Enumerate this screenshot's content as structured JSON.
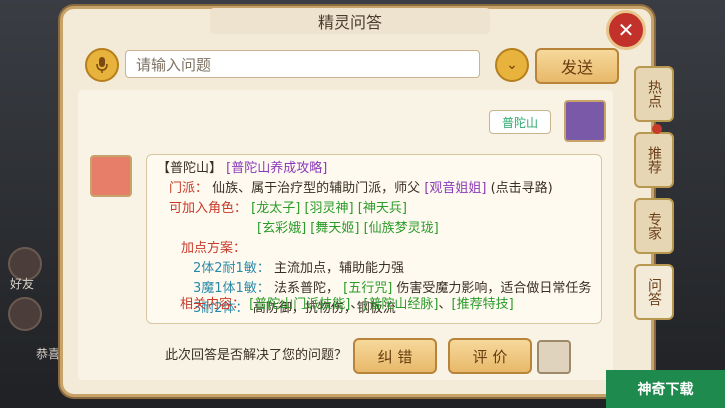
{
  "dialog": {
    "title": "精灵问答"
  },
  "input_bar": {
    "placeholder": "请输入问题",
    "send_label": "发送"
  },
  "user_message": "普陀山",
  "npc_reply": {
    "header_main": "【普陀山】",
    "header_link": "[普陀山养成攻略]",
    "sect_label": "门派：",
    "sect_text": "仙族、属于治疗型的辅助门派，师父",
    "master_link": "[观音姐姐]",
    "master_hint": "(点击寻路)",
    "roles_label": "可加入角色：",
    "roles_row1": [
      "[龙太子]",
      "[羽灵神]",
      "[神天兵]"
    ],
    "roles_row2": [
      "[玄彩娥]",
      "[舞天姬]",
      "[仙族梦灵珑]"
    ],
    "plan_label": "加点方案：",
    "plans": [
      {
        "key": "2体2耐1敏：",
        "desc": "主流加点，辅助能力强"
      },
      {
        "key": "3魔1体1敏：",
        "desc": "法系普陀，",
        "link": "[五行咒]",
        "desc2": "伤害受魔力影响，适合做日常任务"
      },
      {
        "key": "3耐2体：",
        "desc": "高防御，抗物伤，钢板流"
      }
    ],
    "related_label": "相关内容：",
    "related_links": [
      "[普陀山门派技能]",
      "、",
      "[普陀山经脉]",
      "、",
      "[推荐特技]"
    ]
  },
  "footer": {
    "question": "此次回答是否解决了您的问题？",
    "correct_label": "纠 错",
    "rate_label": "评 价"
  },
  "side_tabs": [
    "热点",
    "推荐",
    "专家",
    "问答"
  ],
  "hud": {
    "friend_label": "好友",
    "extra_label": "恭喜"
  },
  "watermark_text": "神奇下载"
}
